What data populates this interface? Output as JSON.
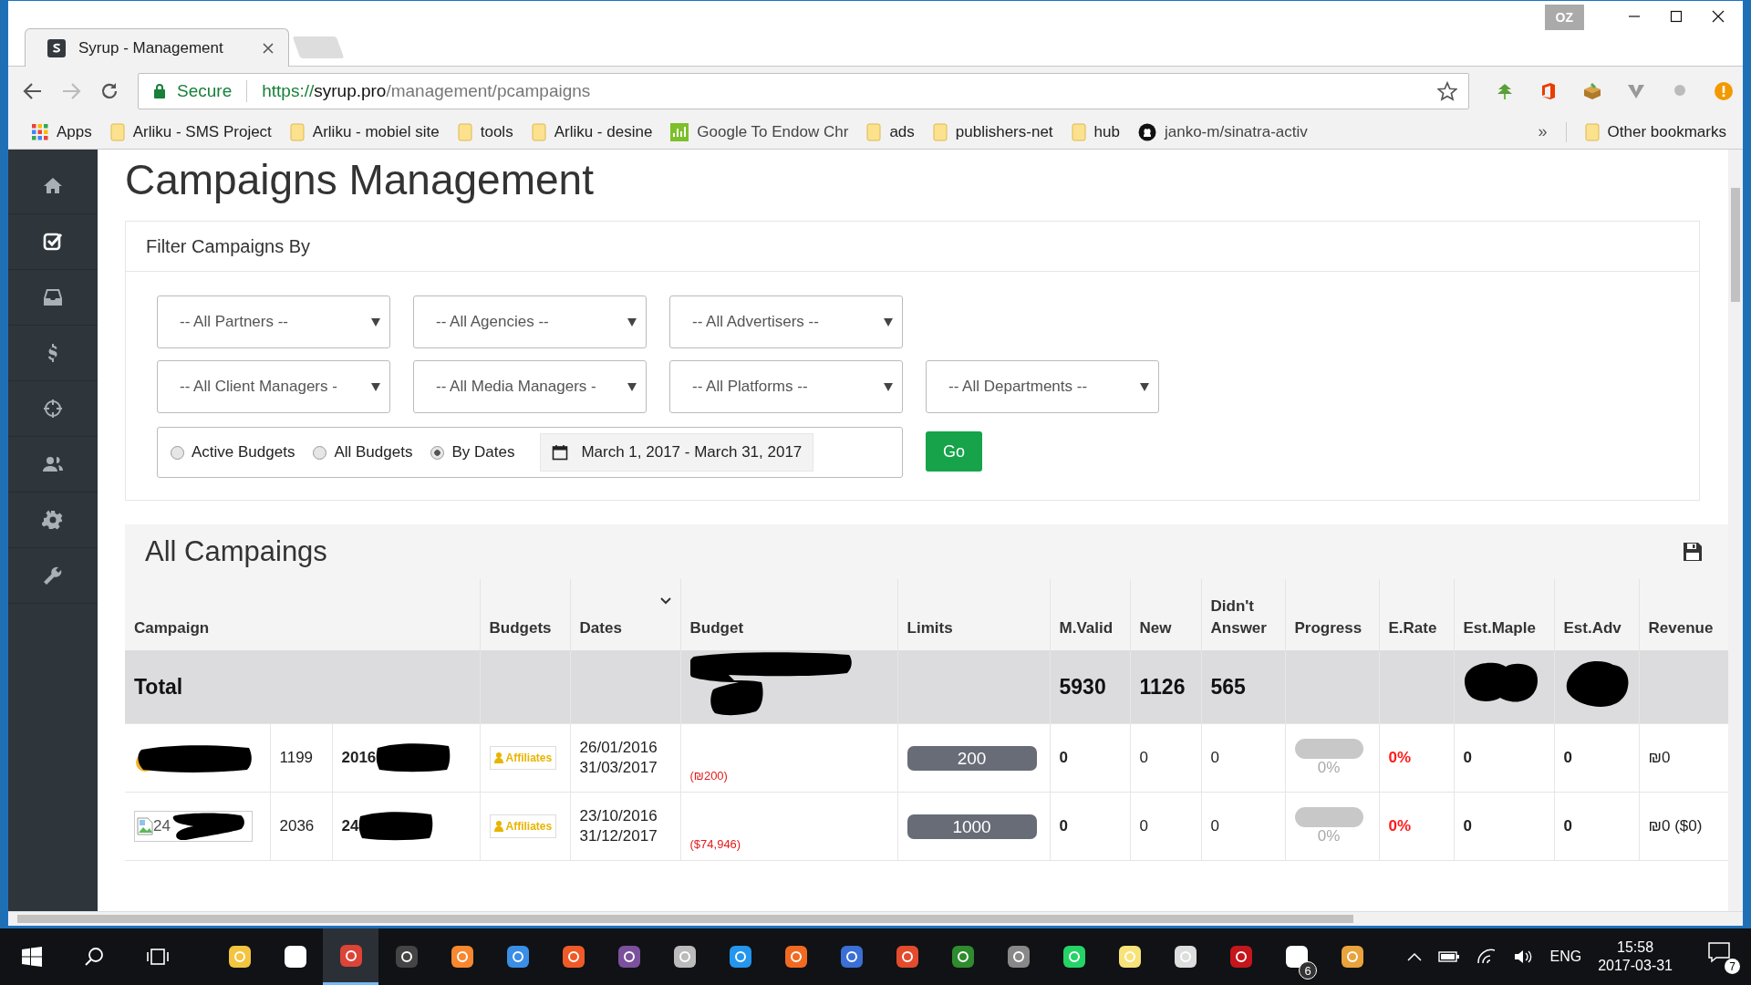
{
  "browser": {
    "tabs": [
      {
        "kind": "page",
        "title": "Syrup - Management",
        "selected": true
      },
      {
        "kind": "new",
        "selected": false
      }
    ],
    "profile": "OZ",
    "security": "Secure",
    "url": {
      "scheme": "https://",
      "host": "syrup.pro",
      "path": "/management/pcampaigns"
    },
    "bookmarks": [
      {
        "kind": "apps",
        "label": "Apps"
      },
      {
        "kind": "folder",
        "label": "Arliku - SMS Project"
      },
      {
        "kind": "folder",
        "label": "Arliku - mobiel site"
      },
      {
        "kind": "folder",
        "label": "tools"
      },
      {
        "kind": "folder",
        "label": "Arliku - desine"
      },
      {
        "kind": "site",
        "label": "Google To Endow Chr"
      },
      {
        "kind": "folder",
        "label": "ads"
      },
      {
        "kind": "folder",
        "label": "publishers-net"
      },
      {
        "kind": "folder",
        "label": "hub"
      },
      {
        "kind": "github",
        "label": "janko-m/sinatra-activ"
      }
    ],
    "overflow": "»",
    "other_bookmarks": "Other bookmarks"
  },
  "sidebar": {
    "items": [
      {
        "kind": "home",
        "selected": false
      },
      {
        "kind": "check",
        "selected": true
      },
      {
        "kind": "inbox",
        "selected": false
      },
      {
        "kind": "dollar",
        "selected": false
      },
      {
        "kind": "target",
        "selected": false
      },
      {
        "kind": "users",
        "selected": false
      },
      {
        "kind": "gear",
        "selected": false
      },
      {
        "kind": "wrench",
        "selected": false
      }
    ]
  },
  "page_title": "Campaigns Management",
  "filter": {
    "title": "Filter Campaigns By",
    "select_rows": [
      [
        "-- All Partners --",
        "-- All Agencies --",
        "-- All Advertisers --"
      ],
      [
        "-- All Client Managers -",
        "-- All Media Managers -",
        "-- All Platforms --",
        "-- All Departments --"
      ]
    ],
    "radios": [
      {
        "label": "Active Budgets",
        "selected": false
      },
      {
        "label": "All Budgets",
        "selected": false
      },
      {
        "label": "By Dates",
        "selected": true
      }
    ],
    "date_range": "March 1, 2017 - March 31, 2017",
    "go": "Go"
  },
  "campaigns": {
    "title": "All Campaings",
    "columns": [
      {
        "label": "Campaign",
        "sorted": false
      },
      {
        "label": "Budgets",
        "sorted": false
      },
      {
        "label": "Dates",
        "sorted": true
      },
      {
        "label": "Budget",
        "sorted": false
      },
      {
        "label": "Limits",
        "sorted": false
      },
      {
        "label": "M.Valid",
        "sorted": false
      },
      {
        "label": "New",
        "sorted": false
      },
      {
        "label": "Didn't Answer",
        "sorted": false
      },
      {
        "label": "Progress",
        "sorted": false
      },
      {
        "label": "E.Rate",
        "sorted": false
      },
      {
        "label": "Est.Maple",
        "sorted": false
      },
      {
        "label": "Est.Adv",
        "sorted": false
      },
      {
        "label": "Revenue",
        "sorted": false
      }
    ],
    "total": {
      "label": "Total",
      "m_valid": "5930",
      "new": "1126",
      "didnt_answer": "565"
    },
    "rows": [
      {
        "image": {
          "kind": "logo"
        },
        "id": "1199",
        "name": "2016",
        "budget_type": "Affiliates",
        "start": "26/01/2016",
        "end": "31/03/2017",
        "budget": "(₪200)",
        "limit": "200",
        "m_valid": "0",
        "new": "0",
        "didnt_answer": "0",
        "progress": {
          "level": 0,
          "label": "0%"
        },
        "e_rate": "0%",
        "est_maple": "0",
        "est_adv": "0",
        "revenue": "₪0"
      },
      {
        "image": {
          "kind": "broken",
          "alt": "24"
        },
        "id": "2036",
        "name": "24",
        "budget_type": "Affiliates",
        "start": "23/10/2016",
        "end": "31/12/2017",
        "budget": "($74,946)",
        "limit": "1000",
        "m_valid": "0",
        "new": "0",
        "didnt_answer": "0",
        "progress": {
          "level": 0,
          "label": "0%"
        },
        "e_rate": "0%",
        "est_maple": "0",
        "est_adv": "0",
        "revenue": "₪0 ($0)"
      }
    ]
  },
  "taskbar": {
    "apps": [
      {
        "kind": "explorer",
        "active": false
      },
      {
        "kind": "store",
        "active": false
      },
      {
        "kind": "chrome",
        "active": true
      },
      {
        "kind": "terminal",
        "active": false
      },
      {
        "kind": "sublime",
        "active": false
      },
      {
        "kind": "player",
        "active": false
      },
      {
        "kind": "pen",
        "active": false
      },
      {
        "kind": "viber",
        "active": false
      },
      {
        "kind": "mouse",
        "active": false
      },
      {
        "kind": "docker",
        "active": false
      },
      {
        "kind": "sync",
        "active": false
      },
      {
        "kind": "network",
        "active": false
      },
      {
        "kind": "git",
        "active": false
      },
      {
        "kind": "lock",
        "active": false
      },
      {
        "kind": "database",
        "active": false
      },
      {
        "kind": "whatsapp",
        "active": false
      },
      {
        "kind": "notes",
        "active": false
      },
      {
        "kind": "calculator",
        "active": false
      },
      {
        "kind": "shield",
        "active": false
      },
      {
        "kind": "mail",
        "active": false,
        "badge": "6"
      },
      {
        "kind": "paint",
        "active": false
      }
    ],
    "language": "ENG",
    "time": "15:58",
    "date": "2017-03-31",
    "notifications": "7"
  }
}
